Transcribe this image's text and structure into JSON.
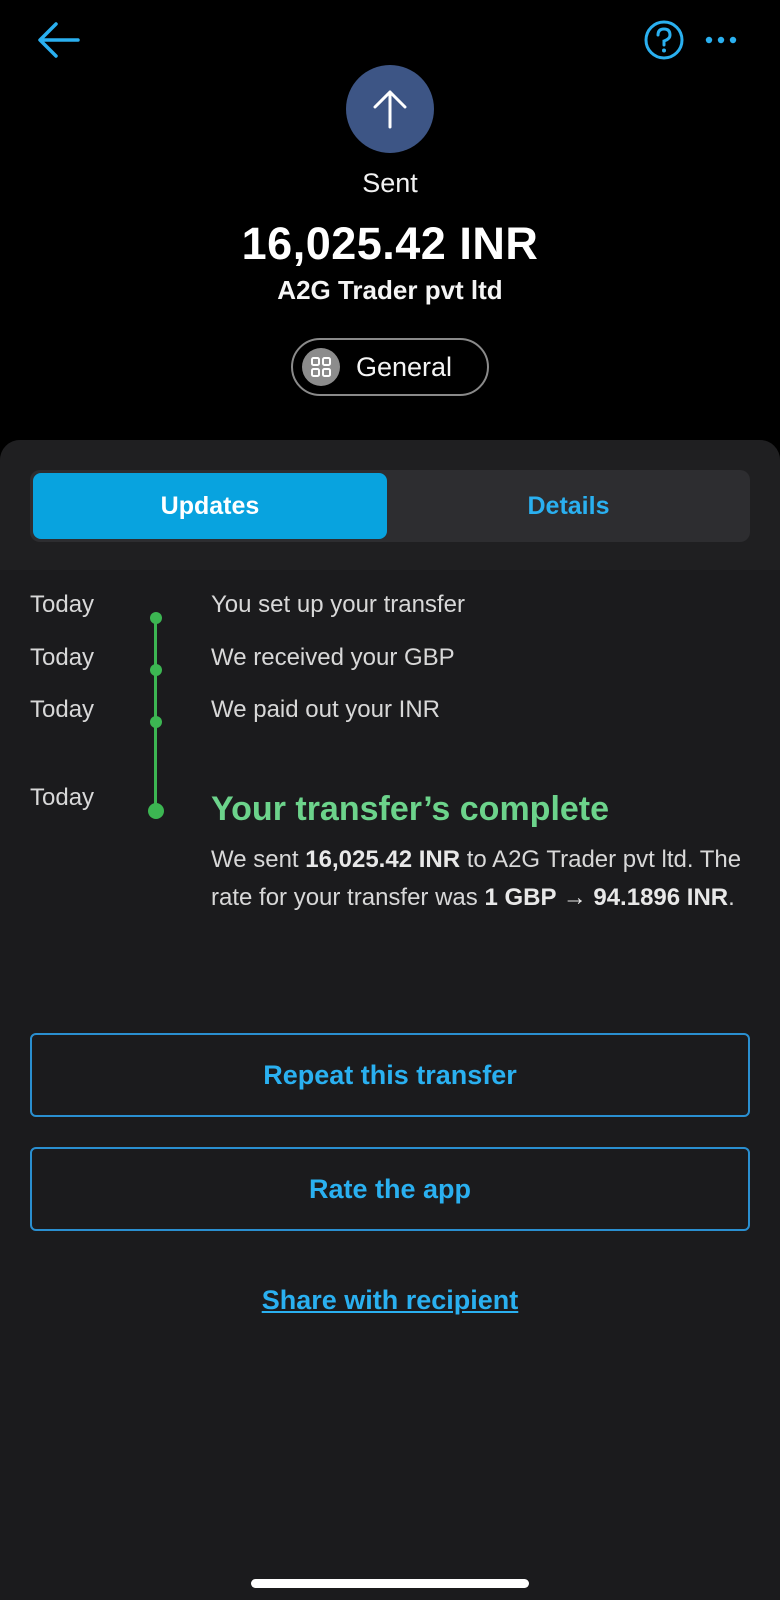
{
  "header": {
    "back_icon": "arrow-left-icon",
    "help_icon": "question-circle-icon",
    "more_icon": "ellipsis-icon",
    "accent_color": "#2ab0f0"
  },
  "summary": {
    "status_icon": "arrow-up-icon",
    "status_label": "Sent",
    "amount": "16,025.42 INR",
    "recipient": "A2G Trader pvt ltd",
    "category_icon": "grid-icon",
    "category_label": "General"
  },
  "tabs": [
    {
      "label": "Updates",
      "active": true
    },
    {
      "label": "Details",
      "active": false
    }
  ],
  "timeline": [
    {
      "date": "Today",
      "text": "You set up your transfer"
    },
    {
      "date": "Today",
      "text": "We received your GBP"
    },
    {
      "date": "Today",
      "text": "We paid out your INR"
    }
  ],
  "complete": {
    "date": "Today",
    "title": "Your transfer’s complete",
    "desc_prefix": "We sent ",
    "desc_amount": "16,025.42 INR",
    "desc_middle": " to A2G Trader pvt ltd. The rate for your transfer was ",
    "desc_rate": "1 GBP → 94.1896 INR",
    "desc_suffix": ".",
    "success_color": "#6cd38b"
  },
  "actions": {
    "repeat_label": "Repeat this transfer",
    "rate_label": "Rate the app",
    "share_label": "Share with recipient"
  }
}
